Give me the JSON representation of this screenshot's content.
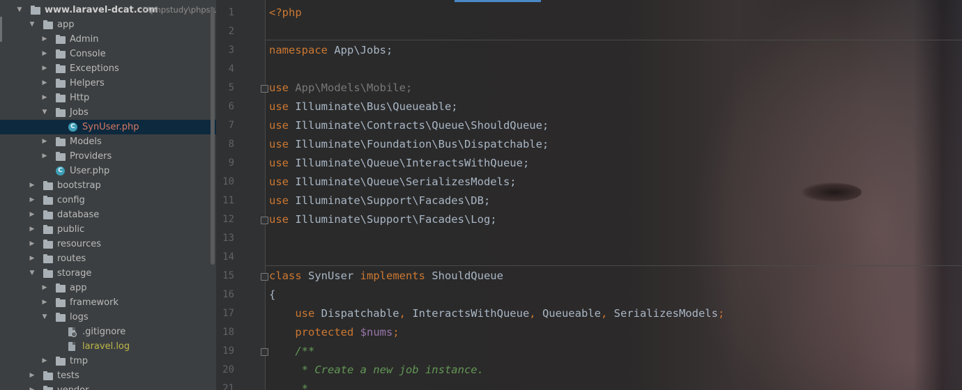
{
  "project_tree": {
    "items": [
      {
        "label": "www.laravel-dcat.com",
        "path": "I:\\phpstudy\\phpstudy_",
        "type": "project",
        "depth": 0,
        "expanded": true
      },
      {
        "label": "app",
        "type": "folder",
        "depth": 1,
        "expanded": true
      },
      {
        "label": "Admin",
        "type": "folder",
        "depth": 2,
        "expanded": false
      },
      {
        "label": "Console",
        "type": "folder",
        "depth": 2,
        "expanded": false
      },
      {
        "label": "Exceptions",
        "type": "folder",
        "depth": 2,
        "expanded": false
      },
      {
        "label": "Helpers",
        "type": "folder",
        "depth": 2,
        "expanded": false
      },
      {
        "label": "Http",
        "type": "folder",
        "depth": 2,
        "expanded": false
      },
      {
        "label": "Jobs",
        "type": "folder",
        "depth": 2,
        "expanded": true
      },
      {
        "label": "SynUser.php",
        "type": "class",
        "depth": 3,
        "selected": true,
        "color": "#d77a64"
      },
      {
        "label": "Models",
        "type": "folder",
        "depth": 2,
        "expanded": false
      },
      {
        "label": "Providers",
        "type": "folder",
        "depth": 2,
        "expanded": false
      },
      {
        "label": "User.php",
        "type": "class",
        "depth": 2
      },
      {
        "label": "bootstrap",
        "type": "folder",
        "depth": 1,
        "expanded": false
      },
      {
        "label": "config",
        "type": "folder",
        "depth": 1,
        "expanded": false
      },
      {
        "label": "database",
        "type": "folder",
        "depth": 1,
        "expanded": false
      },
      {
        "label": "public",
        "type": "folder",
        "depth": 1,
        "expanded": false
      },
      {
        "label": "resources",
        "type": "folder",
        "depth": 1,
        "expanded": false
      },
      {
        "label": "routes",
        "type": "folder",
        "depth": 1,
        "expanded": false
      },
      {
        "label": "storage",
        "type": "folder",
        "depth": 1,
        "expanded": true
      },
      {
        "label": "app",
        "type": "folder",
        "depth": 2,
        "expanded": false
      },
      {
        "label": "framework",
        "type": "folder",
        "depth": 2,
        "expanded": false
      },
      {
        "label": "logs",
        "type": "folder",
        "depth": 2,
        "expanded": true
      },
      {
        "label": ".gitignore",
        "type": "gitignore",
        "depth": 3
      },
      {
        "label": "laravel.log",
        "type": "log",
        "depth": 3,
        "color": "#bdb74a"
      },
      {
        "label": "tmp",
        "type": "folder",
        "depth": 2,
        "expanded": false
      },
      {
        "label": "tests",
        "type": "folder",
        "depth": 1,
        "expanded": false
      },
      {
        "label": "vendor",
        "type": "folder",
        "depth": 1,
        "expanded": false
      }
    ]
  },
  "editor": {
    "lines": [
      {
        "n": "1",
        "tokens": [
          [
            "tag",
            "<?php"
          ]
        ]
      },
      {
        "n": "2",
        "tokens": []
      },
      {
        "n": "3",
        "tokens": [
          [
            "kw",
            "namespace "
          ],
          [
            "plain",
            "App\\Jobs;"
          ]
        ]
      },
      {
        "n": "4",
        "tokens": []
      },
      {
        "n": "5",
        "fold": true,
        "tokens": [
          [
            "kw",
            "use "
          ],
          [
            "dim",
            "App\\Models\\Mobile;"
          ]
        ]
      },
      {
        "n": "6",
        "tokens": [
          [
            "kw",
            "use "
          ],
          [
            "plain",
            "Illuminate\\Bus\\Queueable;"
          ]
        ]
      },
      {
        "n": "7",
        "tokens": [
          [
            "kw",
            "use "
          ],
          [
            "plain",
            "Illuminate\\Contracts\\Queue\\ShouldQueue;"
          ]
        ]
      },
      {
        "n": "8",
        "tokens": [
          [
            "kw",
            "use "
          ],
          [
            "plain",
            "Illuminate\\Foundation\\Bus\\Dispatchable;"
          ]
        ]
      },
      {
        "n": "9",
        "tokens": [
          [
            "kw",
            "use "
          ],
          [
            "plain",
            "Illuminate\\Queue\\InteractsWithQueue;"
          ]
        ]
      },
      {
        "n": "10",
        "tokens": [
          [
            "kw",
            "use "
          ],
          [
            "plain",
            "Illuminate\\Queue\\SerializesModels;"
          ]
        ]
      },
      {
        "n": "11",
        "tokens": [
          [
            "kw",
            "use "
          ],
          [
            "plain",
            "Illuminate\\Support\\Facades\\DB;"
          ]
        ]
      },
      {
        "n": "12",
        "fold": true,
        "tokens": [
          [
            "kw",
            "use "
          ],
          [
            "plain",
            "Illuminate\\Support\\Facades\\Log;"
          ]
        ]
      },
      {
        "n": "13",
        "tokens": []
      },
      {
        "n": "14",
        "tokens": []
      },
      {
        "n": "15",
        "fold": true,
        "tokens": [
          [
            "kw",
            "class "
          ],
          [
            "plain",
            "SynUser "
          ],
          [
            "kw",
            "implements "
          ],
          [
            "plain",
            "ShouldQueue"
          ]
        ]
      },
      {
        "n": "16",
        "tokens": [
          [
            "plain",
            "{"
          ]
        ]
      },
      {
        "n": "17",
        "tokens": [
          [
            "plain",
            "    "
          ],
          [
            "kw",
            "use "
          ],
          [
            "plain",
            "Dispatchable"
          ],
          [
            "kw",
            ", "
          ],
          [
            "plain",
            "InteractsWithQueue"
          ],
          [
            "kw",
            ", "
          ],
          [
            "plain",
            "Queueable"
          ],
          [
            "kw",
            ", "
          ],
          [
            "plain",
            "SerializesModels"
          ],
          [
            "kw",
            ";"
          ]
        ]
      },
      {
        "n": "18",
        "tokens": [
          [
            "plain",
            "    "
          ],
          [
            "kw",
            "protected "
          ],
          [
            "var",
            "$nums"
          ],
          [
            "kw",
            ";"
          ]
        ]
      },
      {
        "n": "19",
        "fold": true,
        "tokens": [
          [
            "plain",
            "    "
          ],
          [
            "doc",
            "/**"
          ]
        ]
      },
      {
        "n": "20",
        "tokens": [
          [
            "plain",
            "    "
          ],
          [
            "doc",
            " * Create a new job instance."
          ]
        ]
      },
      {
        "n": "21",
        "tokens": [
          [
            "plain",
            "    "
          ],
          [
            "doc",
            " *"
          ]
        ]
      }
    ]
  }
}
